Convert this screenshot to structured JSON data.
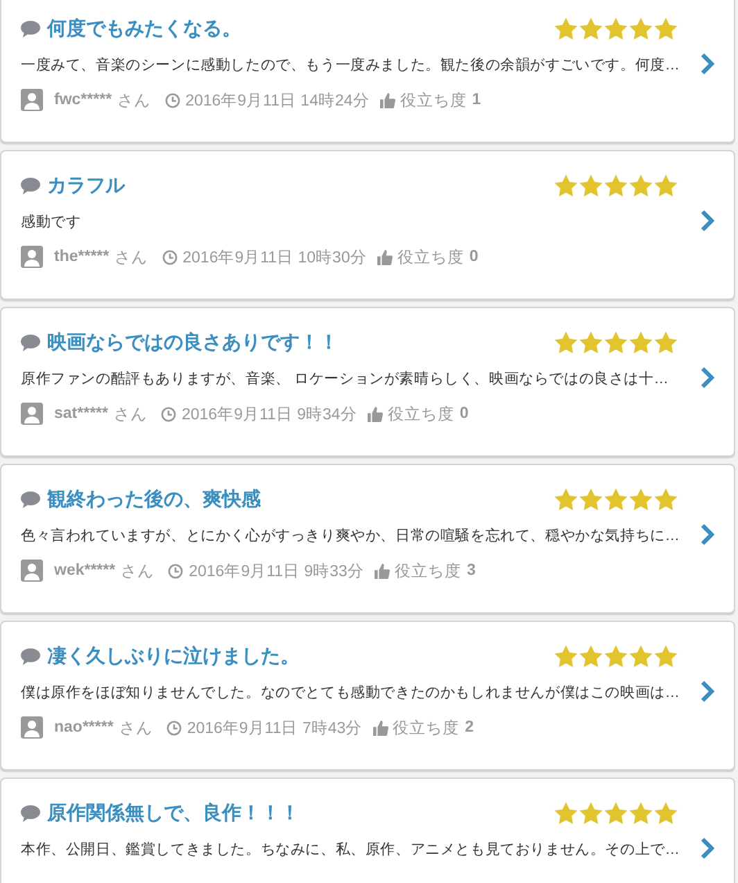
{
  "reviews": [
    {
      "title": "何度でもみたくなる。",
      "stars": 5,
      "body": "一度みて、音楽のシーンに感動したので、もう一度みました。観た後の余韻がすごいです。何度…",
      "user": "fwc*****",
      "honorific": "さん",
      "date": "2016年9月11日 14時24分",
      "helpful_label": "役立ち度",
      "helpful": "1"
    },
    {
      "title": "カラフル",
      "stars": 5,
      "body": "感動です",
      "user": "the*****",
      "honorific": "さん",
      "date": "2016年9月11日 10時30分",
      "helpful_label": "役立ち度",
      "helpful": "0"
    },
    {
      "title": "映画ならではの良さありです！！",
      "stars": 5,
      "body": "原作ファンの酷評もありますが、音楽、 ロケーションが素晴らしく、映画ならではの良さは十…",
      "user": "sat*****",
      "honorific": "さん",
      "date": "2016年9月11日 9時34分",
      "helpful_label": "役立ち度",
      "helpful": "0"
    },
    {
      "title": "観終わった後の、爽快感",
      "stars": 5,
      "body": "色々言われていますが、とにかく心がすっきり爽やか、日常の喧騒を忘れて、穏やかな気持ちに…",
      "user": "wek*****",
      "honorific": "さん",
      "date": "2016年9月11日 9時33分",
      "helpful_label": "役立ち度",
      "helpful": "3"
    },
    {
      "title": "凄く久しぶりに泣けました。",
      "stars": 5,
      "body": "僕は原作をほぼ知りませんでした。なのでとても感動できたのかもしれませんが僕はこの映画は…",
      "user": "nao*****",
      "honorific": "さん",
      "date": "2016年9月11日 7時43分",
      "helpful_label": "役立ち度",
      "helpful": "2"
    },
    {
      "title": "原作関係無しで、良作！！！",
      "stars": 5,
      "body": "本作、公開日、鑑賞してきました。ちなみに、私、原作、アニメとも見ておりません。その上で…"
    }
  ]
}
